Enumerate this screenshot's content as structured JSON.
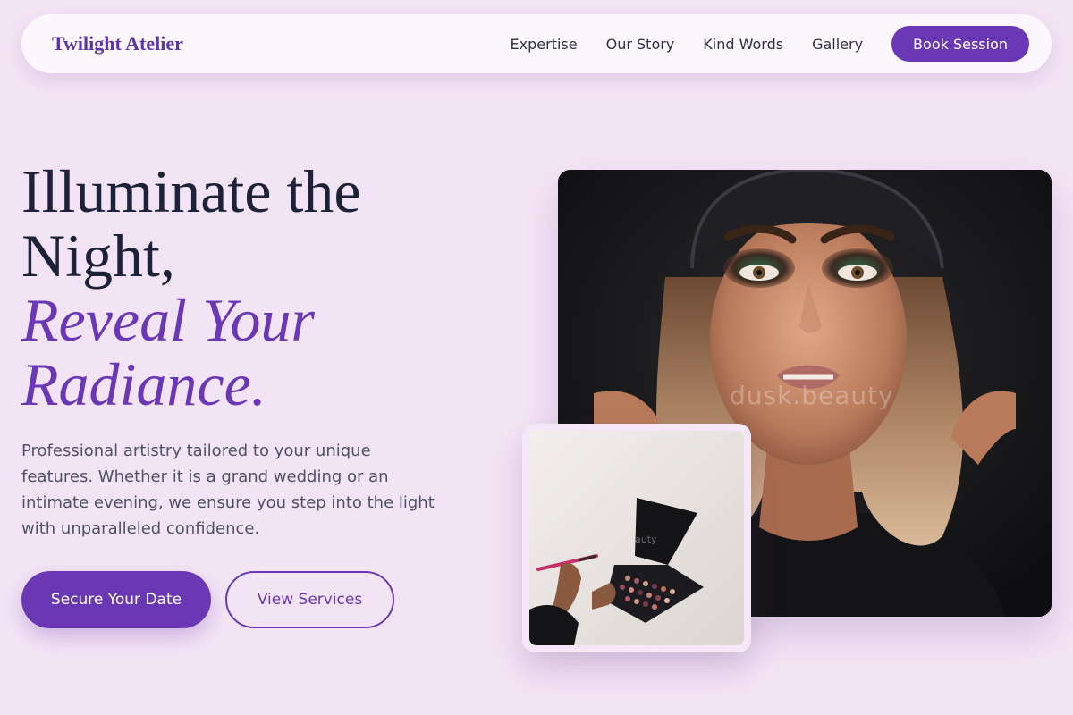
{
  "nav": {
    "logo": "Twilight Atelier",
    "links": [
      "Expertise",
      "Our Story",
      "Kind Words",
      "Gallery"
    ],
    "cta": "Book Session"
  },
  "hero": {
    "title_line1": "Illuminate the",
    "title_line2": "Night,",
    "accent_line1": "Reveal Your",
    "accent_line2": "Radiance.",
    "description": "Professional artistry tailored to your unique features. Whether it is a grand wedding or an intimate evening, we ensure you step into the light with unparalleled confidence.",
    "primary_button": "Secure Your Date",
    "secondary_button": "View Services"
  },
  "images": {
    "main_watermark": "dusk.beauty",
    "card_watermark": "auty"
  },
  "colors": {
    "background": "#f3e4f5",
    "accent": "#6a38b5",
    "heading": "#1e2238",
    "body_text": "#4e5266"
  }
}
